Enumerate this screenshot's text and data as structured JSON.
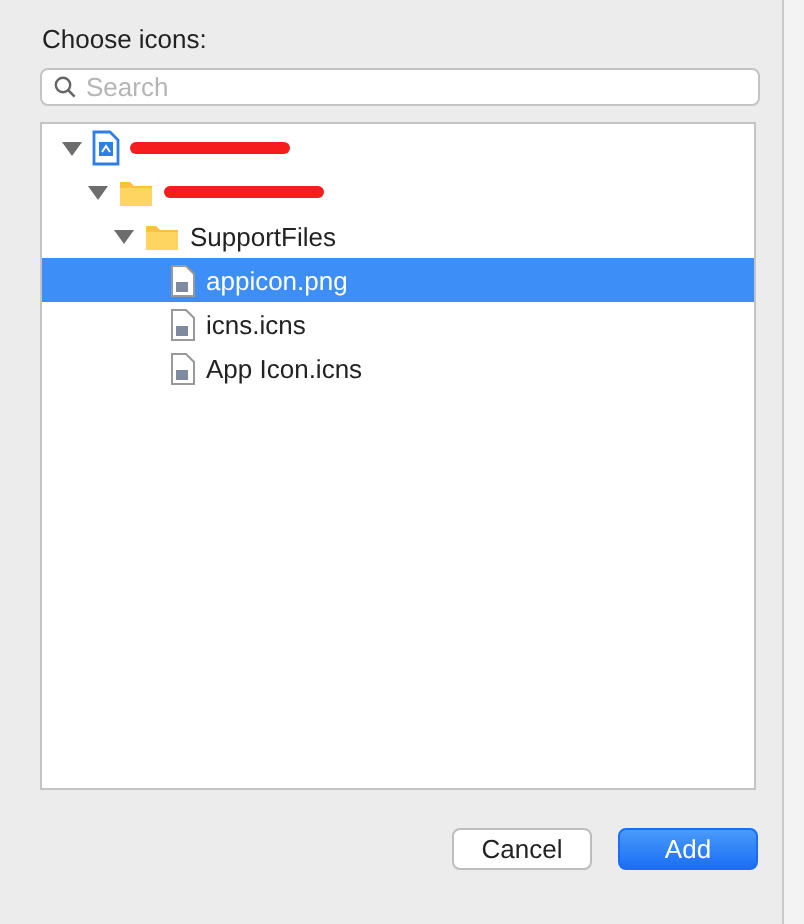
{
  "dialog": {
    "title": "Choose icons:"
  },
  "search": {
    "placeholder": "Search"
  },
  "tree": [
    {
      "kind": "project",
      "redacted": true,
      "expanded": true,
      "selected": false,
      "children": [
        {
          "kind": "folder",
          "redacted": true,
          "expanded": true,
          "selected": false,
          "children": [
            {
              "kind": "folder",
              "label": "SupportFiles",
              "expanded": true,
              "selected": false,
              "children": [
                {
                  "kind": "file",
                  "label": "appicon.png",
                  "selected": true
                },
                {
                  "kind": "file",
                  "label": "icns.icns",
                  "selected": false
                },
                {
                  "kind": "file",
                  "label": "App Icon.icns",
                  "selected": false
                }
              ]
            }
          ]
        }
      ]
    }
  ],
  "buttons": [
    {
      "label": "Cancel",
      "kind": "secondary"
    },
    {
      "label": "Add",
      "kind": "primary"
    }
  ]
}
